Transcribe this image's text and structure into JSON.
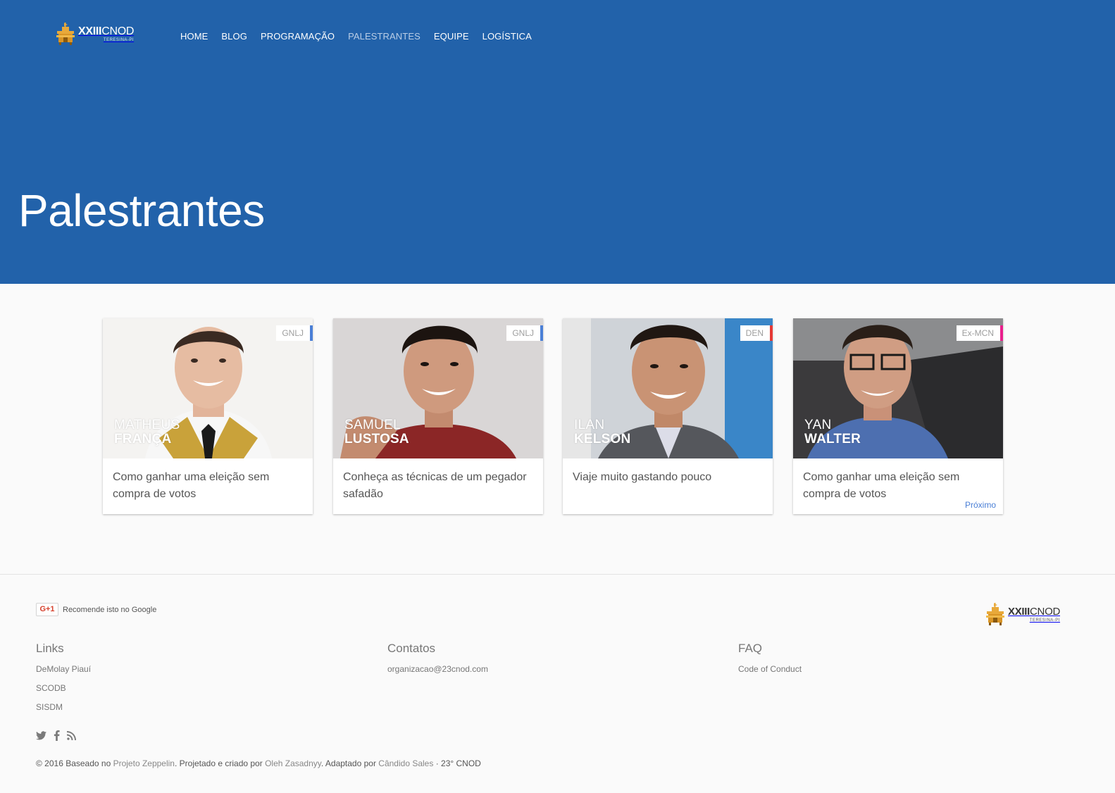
{
  "header": {
    "logo": {
      "title_bold": "XXIII",
      "title_rest": "CNOD",
      "subtitle": "TERESINA-PI"
    },
    "nav": [
      {
        "label": "HOME"
      },
      {
        "label": "BLOG"
      },
      {
        "label": "PROGRAMAÇÃO"
      },
      {
        "label": "PALESTRANTES"
      },
      {
        "label": "EQUIPE"
      },
      {
        "label": "LOGÍSTICA"
      }
    ],
    "active_nav": "PALESTRANTES",
    "colors": {
      "hero_bg": "#2262aa",
      "nav_active": "#b9cde6"
    }
  },
  "hero": {
    "title": "Palestrantes"
  },
  "speakers": [
    {
      "first": "MATHEUS",
      "last": "FRANÇA",
      "badge": "GNLJ",
      "badge_color": "#4a7fd6",
      "talk": "Como ganhar uma eleição sem compra de votos"
    },
    {
      "first": "SAMUEL",
      "last": "LUSTOSA",
      "badge": "GNLJ",
      "badge_color": "#4a7fd6",
      "talk": "Conheça as técnicas de um pegador safadão"
    },
    {
      "first": "ILAN",
      "last": "KELSON",
      "badge": "DEN",
      "badge_color": "#e53935",
      "talk": "Viaje muito gastando pouco"
    },
    {
      "first": "YAN",
      "last": "WALTER",
      "badge": "Ex-MCN",
      "badge_color": "#e91e8c",
      "talk": "Como ganhar uma eleição sem compra de votos"
    }
  ],
  "next_label": "Próximo",
  "footer": {
    "gplus": {
      "button": "G+1",
      "label": "Recomende isto no Google"
    },
    "logo": {
      "title_bold": "XXIII",
      "title_rest": "CNOD",
      "subtitle": "TERESINA-PI"
    },
    "columns": [
      {
        "title": "Links",
        "links": [
          "DeMolay Piauí",
          "SCODB",
          "SISDM"
        ]
      },
      {
        "title": "Contatos",
        "links": [
          "organizacao@23cnod.com"
        ]
      },
      {
        "title": "FAQ",
        "links": [
          "Code of Conduct"
        ]
      }
    ],
    "social": [
      "twitter-icon",
      "facebook-icon",
      "rss-icon"
    ],
    "copyright": {
      "prefix": "© 2016 Baseado no ",
      "link1": "Projeto Zeppelin",
      "mid1": ". Projetado e criado por ",
      "link2": "Oleh Zasadnyy",
      "mid2": ". Adaptado por ",
      "link3": "Cândido Sales",
      "suffix": " · 23° CNOD"
    }
  }
}
